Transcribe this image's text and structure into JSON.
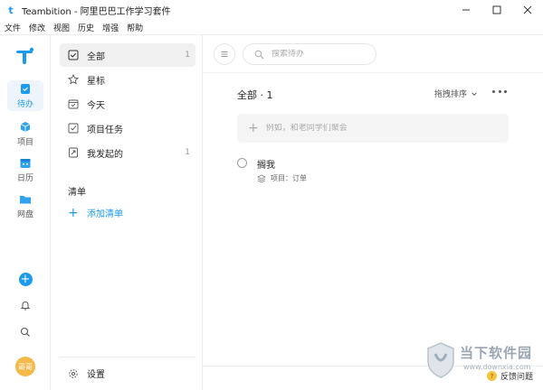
{
  "window": {
    "title": "Teambition - 阿里巴巴工作学习套件",
    "logo_letter": "t"
  },
  "menubar": {
    "items": [
      "文件",
      "修改",
      "视图",
      "历史",
      "增强",
      "帮助"
    ]
  },
  "rail": {
    "items": [
      {
        "label": "待办",
        "icon": "todo-icon",
        "active": true
      },
      {
        "label": "项目",
        "icon": "project-cube-icon",
        "active": false
      },
      {
        "label": "日历",
        "icon": "calendar-icon",
        "active": false
      },
      {
        "label": "网盘",
        "icon": "folder-icon",
        "active": false
      }
    ],
    "avatar_text": "哥哥",
    "accent_color": "#1b9aee"
  },
  "nav": {
    "items": [
      {
        "label": "全部",
        "count": "1",
        "icon": "checkbox-icon",
        "active": true
      },
      {
        "label": "星标",
        "count": "",
        "icon": "star-icon",
        "active": false
      },
      {
        "label": "今天",
        "count": "",
        "icon": "calendar-today-icon",
        "active": false
      },
      {
        "label": "项目任务",
        "count": "",
        "icon": "task-check-icon",
        "active": false
      },
      {
        "label": "我发起的",
        "count": "1",
        "icon": "send-icon",
        "active": false
      }
    ],
    "section_title": "清单",
    "add_list_label": "添加清单",
    "settings_label": "设置"
  },
  "main": {
    "search_placeholder": "搜索待办",
    "list_title": "全部 · 1",
    "sort_label": "拖拽排序",
    "quick_add_placeholder": "例如，和老同学们聚会",
    "tasks": [
      {
        "name": "搁我",
        "meta": "项目：订单"
      }
    ]
  },
  "watermark": {
    "title": "当下软件园",
    "url": "www.downxia.com"
  },
  "feedback": {
    "label": "反馈问题",
    "icon_glyph": "?"
  }
}
